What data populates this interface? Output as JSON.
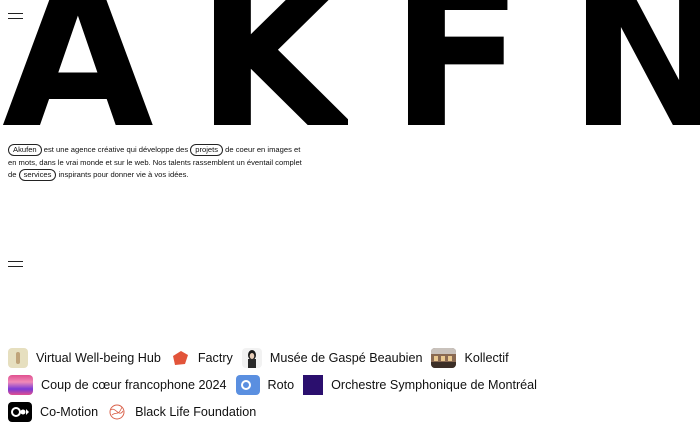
{
  "logo": {
    "letters": [
      "A",
      "K",
      "F",
      "N"
    ]
  },
  "intro": {
    "pill_akufen": "Akufen",
    "text_1": " est une agence créative qui développe des ",
    "pill_projets": "projets",
    "text_2": " de coeur en images et en mots, dans le vrai monde et sur le web. Nos talents rassemblent un éventail complet de ",
    "pill_services": "services",
    "text_3": " inspirants pour donner vie à vos idées."
  },
  "projects": [
    {
      "name": "Virtual Well-being Hub",
      "icon": "wellbeing-thumbnail-icon"
    },
    {
      "name": "Factry",
      "icon": "factry-thumbnail-icon"
    },
    {
      "name": "Musée de Gaspé Beaubien",
      "icon": "musee-thumbnail-icon"
    },
    {
      "name": "Kollectif",
      "icon": "kollectif-thumbnail-icon"
    },
    {
      "name": "Coup de cœur francophone 2024",
      "icon": "coup-de-coeur-thumbnail-icon"
    },
    {
      "name": "Roto",
      "icon": "roto-thumbnail-icon"
    },
    {
      "name": "Orchestre Symphonique de Montréal",
      "icon": "osm-thumbnail-icon"
    },
    {
      "name": "Co-Motion",
      "icon": "co-motion-thumbnail-icon"
    },
    {
      "name": "Black Life Foundation",
      "icon": "black-life-thumbnail-icon"
    }
  ],
  "colors": {
    "text": "#111111",
    "background": "#ffffff",
    "factry": "#e2543a",
    "osm": "#2b0f6e",
    "roto": "#5a8fe0"
  }
}
